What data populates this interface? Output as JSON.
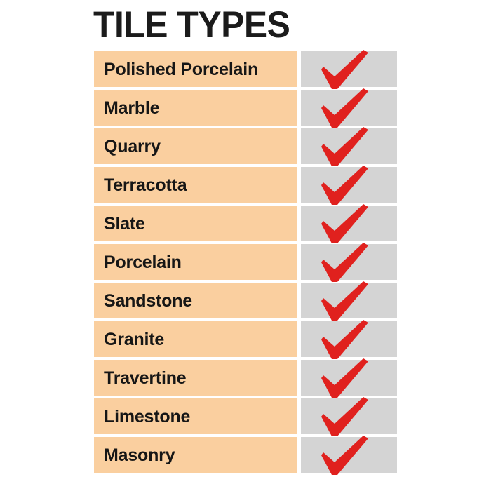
{
  "page": {
    "title": "TILE TYPES",
    "background_color": "#FFFFFF"
  },
  "colors": {
    "title_text": "#1B1B1B",
    "label_cell_background": "#FACF9F",
    "label_text": "#161616",
    "check_cell_background": "#D4D4D4",
    "check_mark": "#E0211E"
  },
  "table": {
    "icon_name": "red-check-mark-icon",
    "rows": [
      {
        "label": "Polished Porcelain",
        "checked": true
      },
      {
        "label": "Marble",
        "checked": true
      },
      {
        "label": "Quarry",
        "checked": true
      },
      {
        "label": "Terracotta",
        "checked": true
      },
      {
        "label": "Slate",
        "checked": true
      },
      {
        "label": "Porcelain",
        "checked": true
      },
      {
        "label": "Sandstone",
        "checked": true
      },
      {
        "label": "Granite",
        "checked": true
      },
      {
        "label": "Travertine",
        "checked": true
      },
      {
        "label": "Limestone",
        "checked": true
      },
      {
        "label": "Masonry",
        "checked": true
      }
    ]
  }
}
